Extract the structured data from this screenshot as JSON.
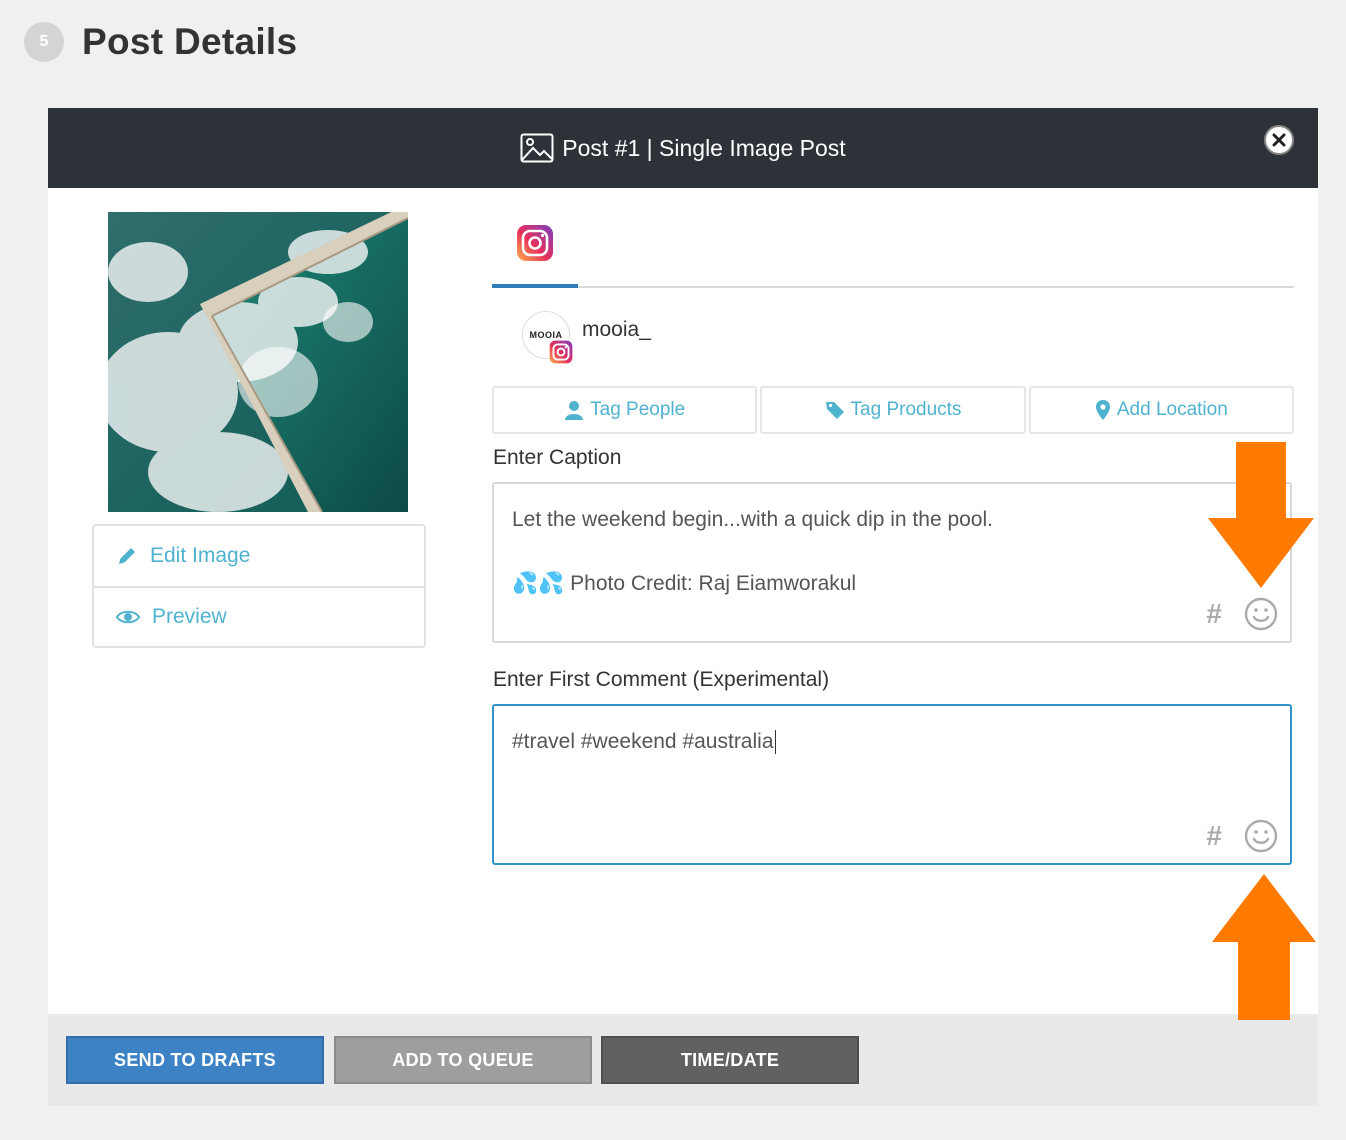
{
  "step": {
    "number": "5",
    "title": "Post Details"
  },
  "modal": {
    "title": "Post #1 | Single Image Post",
    "close_label": "✖"
  },
  "image_actions": {
    "edit": "Edit Image",
    "preview": "Preview"
  },
  "account": {
    "avatar_text": "MOOIA",
    "name": "mooia_"
  },
  "tags": {
    "people": "Tag People",
    "products": "Tag Products",
    "location": "Add Location"
  },
  "caption": {
    "label": "Enter Caption",
    "line1": "Let the weekend begin...with a quick dip in the pool.",
    "emoji": "💦💦",
    "line2": "Photo Credit: Raj Eiamworakul"
  },
  "first_comment": {
    "label": "Enter First Comment (Experimental)",
    "value": "#travel #weekend #australia"
  },
  "hash_symbol": "#",
  "footer": {
    "drafts": "SEND TO DRAFTS",
    "queue": "ADD TO QUEUE",
    "timedate": "TIME/DATE"
  },
  "colors": {
    "accent": "#4fb2cf",
    "header_bg": "#2d3138",
    "primary": "#3d82c4",
    "arrow": "#ff7a00"
  }
}
